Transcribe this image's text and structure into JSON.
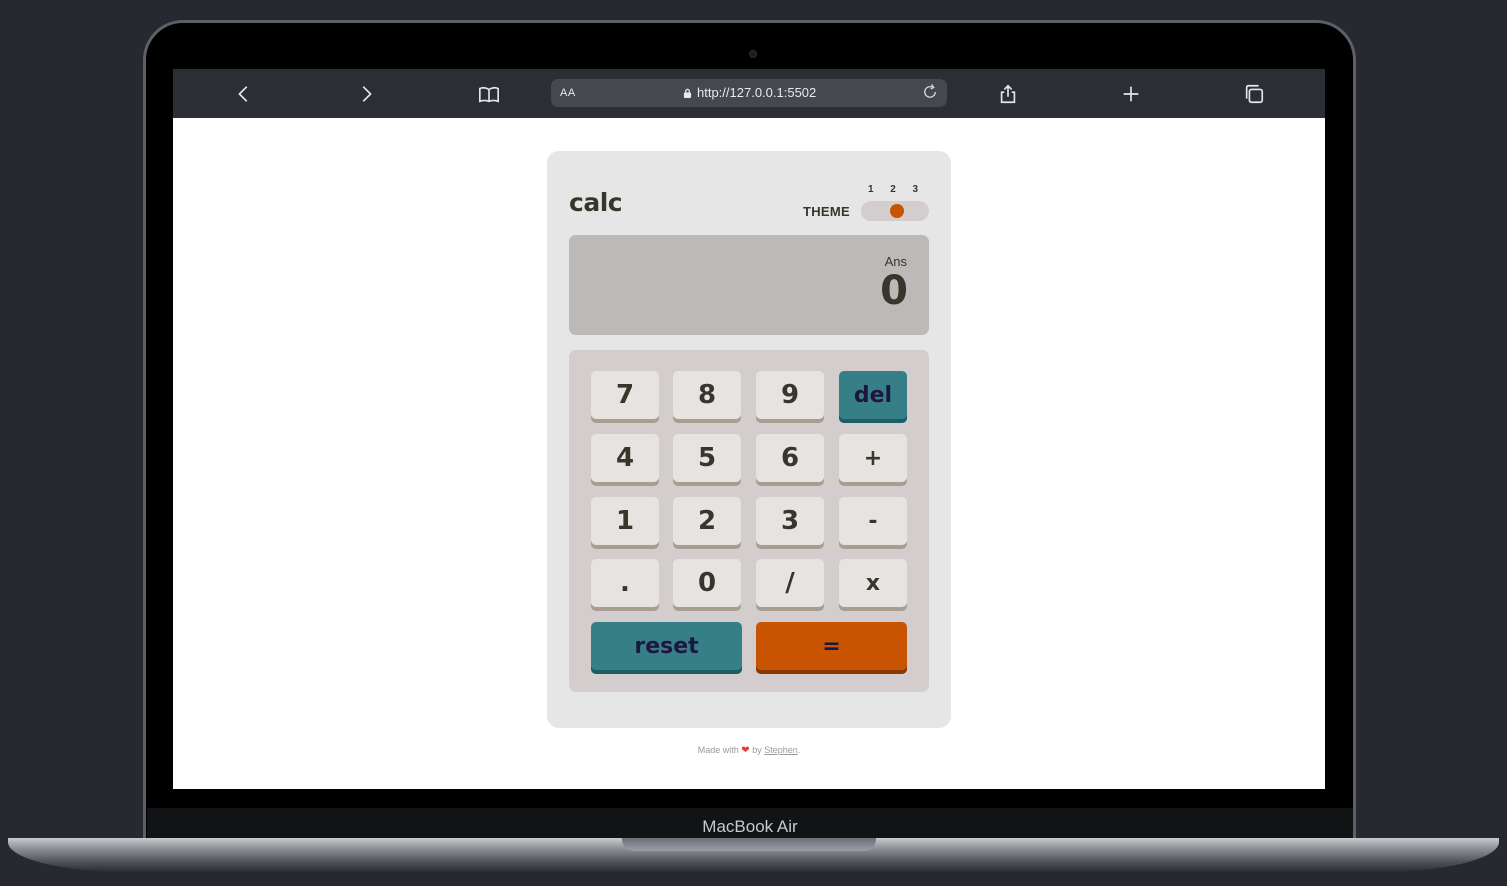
{
  "device": {
    "label": "MacBook Air"
  },
  "browser": {
    "text_size_label": "AA",
    "url": "http://127.0.0.1:5502",
    "icons": [
      "back-icon",
      "forward-icon",
      "bookmarks-icon",
      "lock-icon",
      "reload-icon",
      "share-icon",
      "new-tab-icon",
      "tabs-icon"
    ]
  },
  "calculator": {
    "title": "calc",
    "theme": {
      "label": "THEME",
      "options": [
        "1",
        "2",
        "3"
      ],
      "selected": 2
    },
    "display": {
      "ans_label": "Ans",
      "value": "0"
    },
    "keys": {
      "row1": [
        "7",
        "8",
        "9",
        "del"
      ],
      "row2": [
        "4",
        "5",
        "6",
        "+"
      ],
      "row3": [
        "1",
        "2",
        "3",
        "-"
      ],
      "row4": [
        ".",
        "0",
        "/",
        "x"
      ],
      "reset": "reset",
      "equals": "="
    }
  },
  "footer": {
    "made_with": "Made with",
    "by": "by",
    "author": "Stephen",
    "end": "."
  },
  "colors": {
    "accent_orange": "#c85402",
    "accent_teal": "#377f86",
    "key_bg": "#e5e4e1",
    "text_dark": "#36362c"
  }
}
